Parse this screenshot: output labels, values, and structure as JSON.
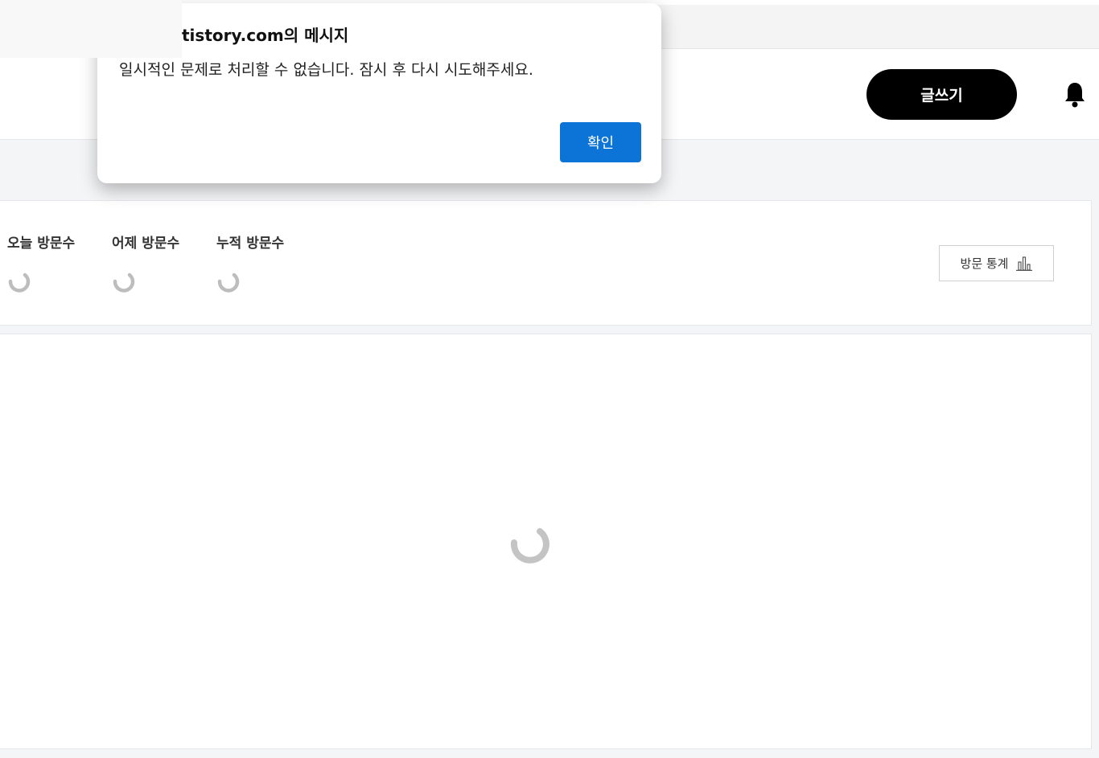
{
  "header": {
    "write_button_label": "글쓰기"
  },
  "stats": {
    "items": [
      {
        "label": "오늘 방문수"
      },
      {
        "label": "어제 방문수"
      },
      {
        "label": "누적 방문수"
      }
    ],
    "stats_button_label": "방문 통계"
  },
  "dialog": {
    "title": "tistory.com의 메시지",
    "message": "일시적인 문제로 처리할 수 없습니다. 잠시 후 다시 시도해주세요.",
    "ok_label": "확인"
  },
  "colors": {
    "accent": "#0b74d6",
    "write_button": "#000000",
    "page_background": "#f4f5f7"
  },
  "icons": {
    "bell": "bell-icon",
    "stats": "bar-chart-icon",
    "loading": "loading-spinner-icon"
  }
}
